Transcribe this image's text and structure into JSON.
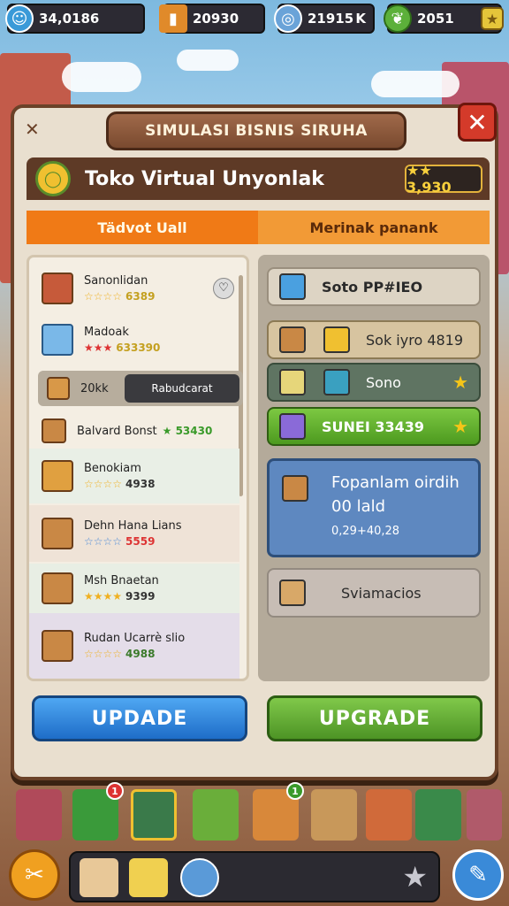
{
  "hud": {
    "coins": "34,0186",
    "books": "20930",
    "gems": "21915",
    "gems_mark": "K",
    "leaves": "2051"
  },
  "dialog": {
    "title": "SIMULASI BISNIS SIRUHA",
    "shop_name": "Toko Virtual Unyonlak",
    "rating": "★★ 3,930"
  },
  "tabs": {
    "left": "Tädvot Uall",
    "right": "Merinak panank"
  },
  "left_list": {
    "items": [
      {
        "name": "Sanonlidan",
        "stars": "☆☆☆☆",
        "price": "6389"
      },
      {
        "name": "Madoak",
        "stars": "★★★",
        "price": "633390"
      }
    ],
    "search": {
      "label": "20kk",
      "button": "Rabudcarat"
    },
    "bundle": {
      "name": "Balvard Bonst",
      "price": "★ 53430"
    },
    "items2": [
      {
        "name": "Benokiam",
        "stars": "☆☆☆☆",
        "price": "4938"
      },
      {
        "name": "Dehn Hana Lians",
        "stars": "☆☆☆☆",
        "price": "5559"
      },
      {
        "name": "Msh Bnaetan",
        "stars": "★★★★",
        "price": "9399"
      },
      {
        "name": "Rudan Ucarrè slio",
        "stars": "☆☆☆☆",
        "price": "4988"
      }
    ]
  },
  "right_panel": {
    "btn1": "Soto PP#IEO",
    "btn2": "Sok iyro 4819",
    "btn3": "Sono",
    "btn4": "SUNEI 33439",
    "big_line1": "Fopanlam oirdih",
    "big_line2": "00 lald",
    "big_line3": "0,29+40,28",
    "btn_bottom": "Sviamacios"
  },
  "buttons": {
    "update": "UPDADE",
    "upgrade": "UPGRADE"
  },
  "dock": {
    "badge1": "1",
    "badge2": "1"
  }
}
